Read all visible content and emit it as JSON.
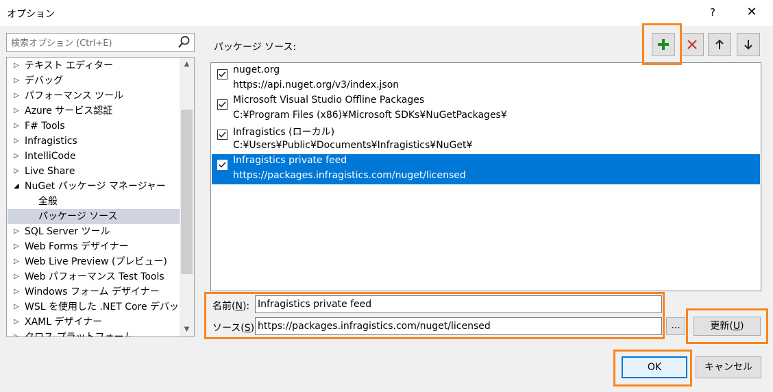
{
  "window": {
    "title": "オプション",
    "help": "?",
    "close": "✕"
  },
  "search": {
    "placeholder": "検索オプション (Ctrl+E)"
  },
  "tree": {
    "items": [
      {
        "label": "テキスト エディター",
        "arrow": "▷"
      },
      {
        "label": "デバッグ",
        "arrow": "▷"
      },
      {
        "label": "パフォーマンス ツール",
        "arrow": "▷"
      },
      {
        "label": "Azure サービス認証",
        "arrow": "▷"
      },
      {
        "label": "F# Tools",
        "arrow": "▷"
      },
      {
        "label": "Infragistics",
        "arrow": "▷"
      },
      {
        "label": "IntelliCode",
        "arrow": "▷"
      },
      {
        "label": "Live Share",
        "arrow": "▷"
      },
      {
        "label": "NuGet パッケージ マネージャー",
        "arrow": "◢"
      },
      {
        "label": "全般",
        "arrow": ""
      },
      {
        "label": "パッケージ ソース",
        "arrow": "",
        "selected": true
      },
      {
        "label": "SQL Server ツール",
        "arrow": "▷"
      },
      {
        "label": "Web Forms デザイナー",
        "arrow": "▷"
      },
      {
        "label": "Web Live Preview (プレビュー)",
        "arrow": "▷"
      },
      {
        "label": "Web パフォーマンス Test Tools",
        "arrow": "▷"
      },
      {
        "label": "Windows フォーム デザイナー",
        "arrow": "▷"
      },
      {
        "label": "WSL を使用した .NET Core デバッグ",
        "arrow": "▷"
      },
      {
        "label": "XAML デザイナー",
        "arrow": "▷"
      },
      {
        "label": "クロス プラットフォーム",
        "arrow": "▷"
      }
    ]
  },
  "package_sources": {
    "label": "パッケージ ソース:",
    "sources": [
      {
        "name": "nuget.org",
        "url": "https://api.nuget.org/v3/index.json",
        "checked": true
      },
      {
        "name": "Microsoft Visual Studio Offline Packages",
        "url": "C:¥Program Files (x86)¥Microsoft SDKs¥NuGetPackages¥",
        "checked": true
      },
      {
        "name": "Infragistics (ローカル)",
        "url": "C:¥Users¥Public¥Documents¥Infragistics¥NuGet¥",
        "checked": true
      },
      {
        "name": "Infragistics private feed",
        "url": "https://packages.infragistics.com/nuget/licensed",
        "checked": true,
        "selected": true
      }
    ]
  },
  "form": {
    "name_label": "名前(",
    "name_key": "N",
    "name_suffix": "):",
    "name_value": "Infragistics private feed",
    "source_label": "ソース(",
    "source_key": "S",
    "source_suffix": "):",
    "source_value": "https://packages.infragistics.com/nuget/licensed",
    "browse": "...",
    "update_label": "更新(",
    "update_key": "U",
    "update_suffix": ")"
  },
  "buttons": {
    "ok": "OK",
    "cancel": "キャンセル"
  },
  "colors": {
    "highlight": "#f7861f",
    "selection": "#0078d7",
    "add_icon": "#1e8c1e",
    "remove_icon": "#c4362a"
  }
}
